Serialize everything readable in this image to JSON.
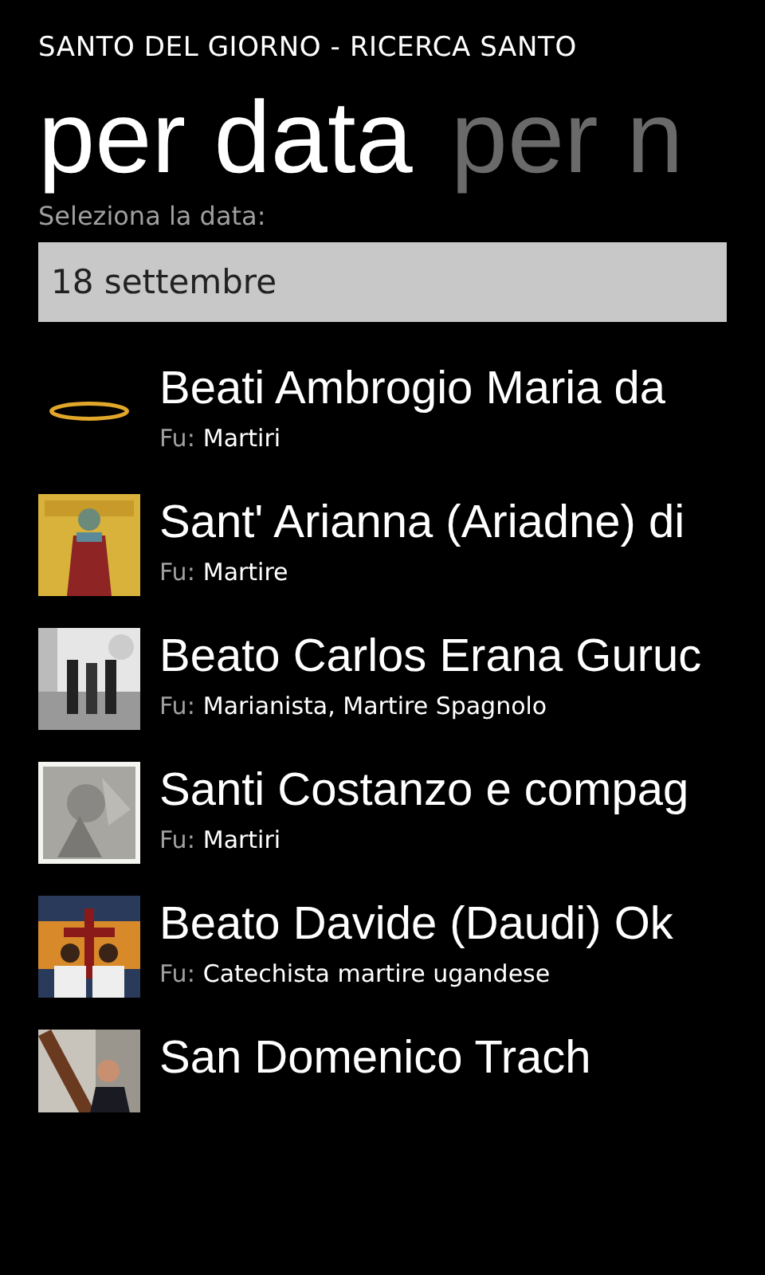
{
  "app_title": "SANTO DEL GIORNO - RICERCA SANTO",
  "pivots": [
    {
      "label": "per data",
      "selected": true
    },
    {
      "label": "per n",
      "selected": false
    }
  ],
  "date_field": {
    "label": "Seleziona la data:",
    "value": "18 settembre"
  },
  "saints": [
    {
      "name": "Beati Ambrogio Maria da",
      "role_label": "Fu:",
      "role": "Martiri",
      "kind": "halo"
    },
    {
      "name": "Sant' Arianna (Ariadne) di",
      "role_label": "Fu:",
      "role": "Martire",
      "kind": "picture"
    },
    {
      "name": "Beato Carlos Erana Guruc",
      "role_label": "Fu:",
      "role": "Marianista, Martire Spagnolo",
      "kind": "picture"
    },
    {
      "name": "Santi Costanzo e compag",
      "role_label": "Fu:",
      "role": "Martiri",
      "kind": "picture"
    },
    {
      "name": "Beato Davide (Daudi) Ok",
      "role_label": "Fu:",
      "role": "Catechista martire ugandese",
      "kind": "picture"
    },
    {
      "name": "San Domenico Trach",
      "kind": "picture"
    }
  ]
}
